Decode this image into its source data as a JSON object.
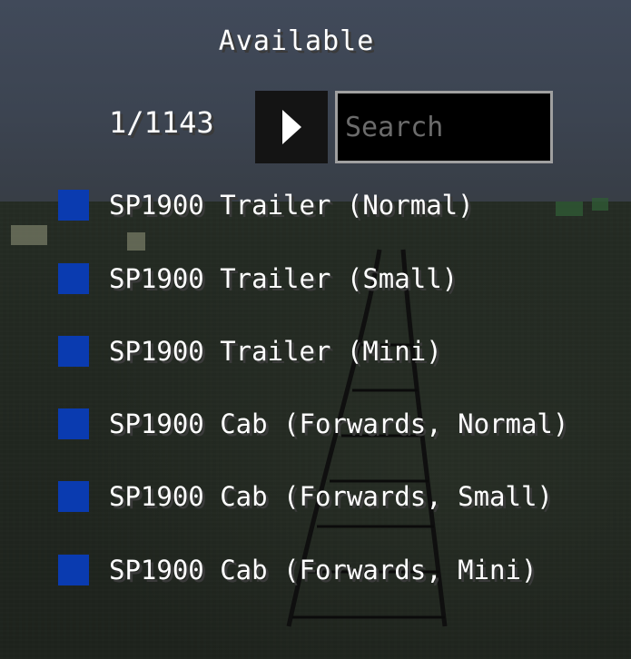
{
  "title": "Available",
  "pagination": {
    "counter": "1/1143"
  },
  "search": {
    "placeholder": "Search",
    "value": ""
  },
  "icons": {
    "next": "play-arrow-icon"
  },
  "colors": {
    "item_swatch": "#0a3bb0",
    "text": "#ffffff",
    "text_shadow": "#3a3a3a",
    "button_bg": "#141414",
    "search_border": "#a0a0a0"
  },
  "items": [
    {
      "label": "SP1900 Trailer (Normal)"
    },
    {
      "label": "SP1900 Trailer (Small)"
    },
    {
      "label": "SP1900 Trailer (Mini)"
    },
    {
      "label": "SP1900 Cab (Forwards, Normal)"
    },
    {
      "label": "SP1900 Cab (Forwards, Small)"
    },
    {
      "label": "SP1900 Cab (Forwards, Mini)"
    }
  ]
}
